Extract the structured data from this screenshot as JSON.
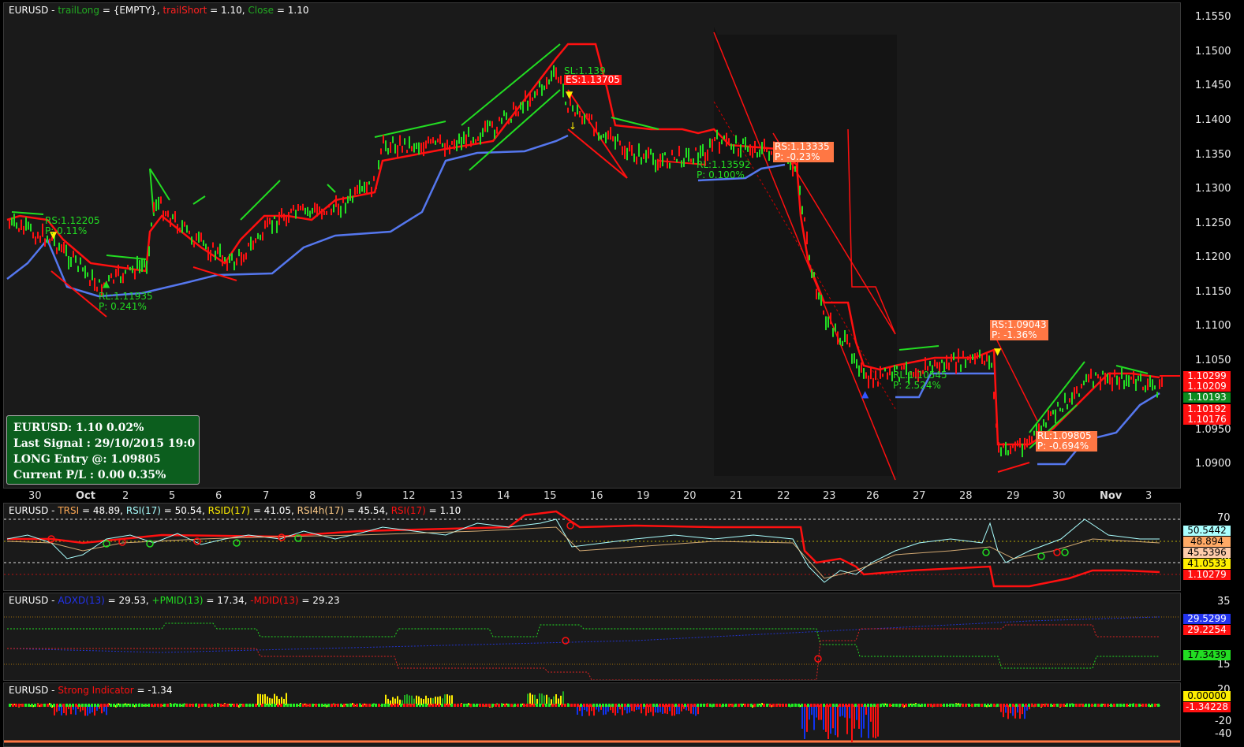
{
  "main_header": {
    "symbol": "EURUSD",
    "trail_long": "trailLong",
    "trail_long_value": " = {EMPTY}, ",
    "trail_short": "trailShort",
    "trail_short_value": " = 1.10, ",
    "close": "Close",
    "close_value": " = 1.10"
  },
  "price_axis": [
    "1.1550",
    "1.1500",
    "1.1450",
    "1.1400",
    "1.1350",
    "1.1300",
    "1.1250",
    "1.1200",
    "1.1150",
    "1.1100",
    "1.1050",
    "1.0950",
    "1.0900"
  ],
  "price_tags": [
    "1.10299",
    "1.10209",
    "1.10193",
    "1.10192",
    "1.10176"
  ],
  "date_axis": [
    "30",
    "Oct",
    "2",
    "5",
    "6",
    "7",
    "8",
    "9",
    "12",
    "13",
    "14",
    "15",
    "16",
    "19",
    "20",
    "21",
    "22",
    "23",
    "26",
    "27",
    "28",
    "29",
    "30",
    "Nov",
    "3"
  ],
  "signals": {
    "rs1": "RS:1.12205",
    "rs1_p": "P:    0.11%",
    "rl1": "RL:1.11935",
    "rl1_p": "P:    0.241%",
    "sl1": "SL:1.139",
    "es1": "ES:1.13705",
    "rs2": "RS:1.13335",
    "rs2_p": "P:   -0.23%",
    "rl2": "RL:1.13592",
    "rl2_p": "P:   0.100%",
    "rl3": "RL:1.10545",
    "rl3_p": "P:   2.524%",
    "rs3": "RS:1.09043",
    "rs3_p": "P:   -1.36%",
    "rl4": "RL:1.09805",
    "rl4_p": "P:   -0.694%"
  },
  "infobox": {
    "line1": "EURUSD:       1.10 0.02%",
    "line2": "Last Signal      : 29/10/2015 19:0",
    "line3": "LONG Entry @: 1.09805",
    "line4": "Current P/L    : 0.00 0.35%"
  },
  "rsi_header": {
    "symbol": "EURUSD",
    "trsi": "TRSI",
    "trsi_value": " = 48.89, ",
    "rsi": "RSI(17)",
    "rsi_value": " = 50.54, ",
    "rsid": "RSID(17)",
    "rsid_value": " = 41.05, ",
    "rsi4h": "RSI4h(17)",
    "rsi4h_value": " = 45.54, ",
    "rsi2": "RSI(17)",
    "rsi2_value": " = 1.10"
  },
  "rsi_axis": [
    "70",
    "30"
  ],
  "rsi_tags": [
    "50.5442",
    "48.894",
    "45.5396",
    "41.0533",
    "1.10279"
  ],
  "adx_header": {
    "symbol": "EURUSD",
    "adx": "ADXD(13)",
    "adx_value": " = 29.53, ",
    "pmi": "+PMID(13)",
    "pmi_value": " = 17.34, ",
    "mdi": "-MDID(13)",
    "mdi_value": " = 29.23"
  },
  "adx_axis": [
    "35",
    "15"
  ],
  "adx_tags": [
    "29.5299",
    "29.2254",
    "17.3439"
  ],
  "strong_header": {
    "symbol": "EURUSD",
    "name": "Strong Indicator",
    "value": " = -1.34"
  },
  "strong_axis": [
    "20",
    "-20",
    "-40"
  ],
  "strong_tags": [
    "0.00000",
    "-1.34228"
  ],
  "colors": {
    "green": "#22dd22",
    "red": "#ff1010",
    "blue": "#5577ee",
    "orange": "#ff7744",
    "yellow": "#ffee00"
  }
}
